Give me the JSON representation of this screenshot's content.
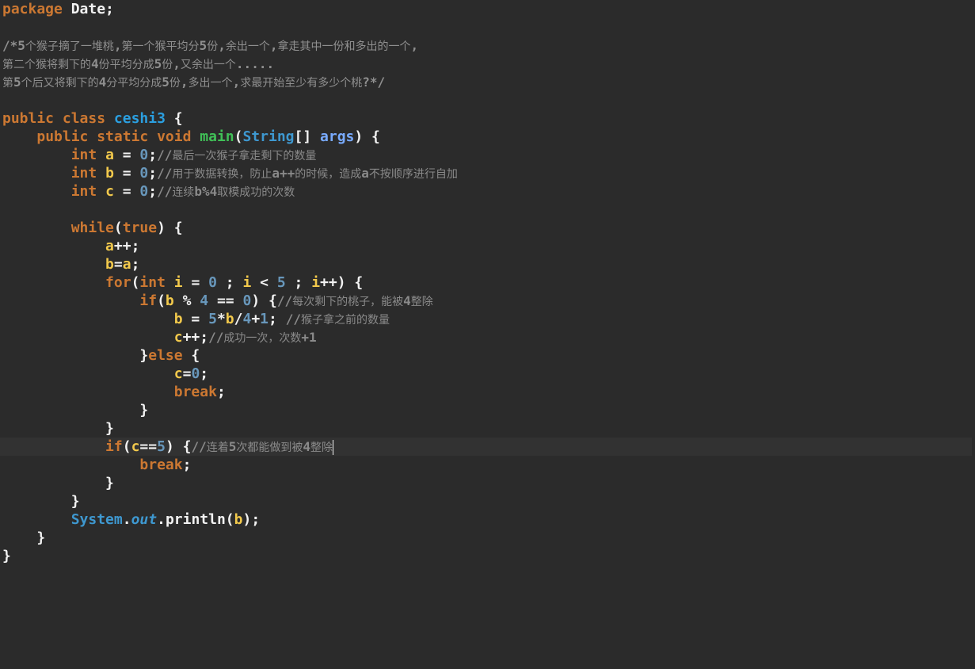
{
  "editor": {
    "lines": [
      {
        "id": "l01",
        "tokens": [
          [
            "kw",
            "package"
          ],
          [
            "plain",
            " Date;"
          ]
        ]
      },
      {
        "id": "l03",
        "tokens": [
          [
            "hdr",
            "/*5个猴子摘了一堆桃,第一个猴平均分5份,余出一个,拿走其中一份和多出的一个,"
          ]
        ]
      },
      {
        "id": "l04",
        "tokens": [
          [
            "hdr",
            "第二个猴将剩下的4份平均分成5份,又余出一个....."
          ]
        ]
      },
      {
        "id": "l05",
        "tokens": [
          [
            "hdr",
            "第5个后又将剩下的4分平均分成5份,多出一个,求最开始至少有多少个桃?*/"
          ]
        ]
      },
      {
        "id": "l07",
        "tokens": [
          [
            "kw",
            "public class "
          ],
          [
            "cls",
            "ceshi3"
          ],
          [
            "plain",
            " {"
          ]
        ]
      },
      {
        "id": "l08",
        "tokens": [
          [
            "plain",
            "    "
          ],
          [
            "kw",
            "public static void "
          ],
          [
            "fn",
            "main"
          ],
          [
            "plain",
            "("
          ],
          [
            "ty",
            "String"
          ],
          [
            "plain",
            "[] "
          ],
          [
            "arg",
            "args"
          ],
          [
            "plain",
            ") {"
          ]
        ]
      },
      {
        "id": "l09",
        "tokens": [
          [
            "plain",
            "        "
          ],
          [
            "kw",
            "int "
          ],
          [
            "var",
            "a"
          ],
          [
            "plain",
            " = "
          ],
          [
            "num",
            "0"
          ],
          [
            "plain",
            ";"
          ],
          [
            "cmt",
            "//最后一次猴子拿走剩下的数量"
          ]
        ]
      },
      {
        "id": "l10",
        "tokens": [
          [
            "plain",
            "        "
          ],
          [
            "kw",
            "int "
          ],
          [
            "var",
            "b"
          ],
          [
            "plain",
            " = "
          ],
          [
            "num",
            "0"
          ],
          [
            "plain",
            ";"
          ],
          [
            "cmt",
            "//用于数据转换，防止a++的时候，造成a不按顺序进行自加"
          ]
        ]
      },
      {
        "id": "l11",
        "tokens": [
          [
            "plain",
            "        "
          ],
          [
            "kw",
            "int "
          ],
          [
            "var",
            "c"
          ],
          [
            "plain",
            " = "
          ],
          [
            "num",
            "0"
          ],
          [
            "plain",
            ";"
          ],
          [
            "cmt",
            "//连续b%4取模成功的次数"
          ]
        ]
      },
      {
        "id": "l13",
        "tokens": [
          [
            "plain",
            "        "
          ],
          [
            "kw",
            "while"
          ],
          [
            "plain",
            "("
          ],
          [
            "kw",
            "true"
          ],
          [
            "plain",
            ") {"
          ]
        ]
      },
      {
        "id": "l14",
        "tokens": [
          [
            "plain",
            "            "
          ],
          [
            "var",
            "a"
          ],
          [
            "plain",
            "++;"
          ]
        ]
      },
      {
        "id": "l15",
        "tokens": [
          [
            "plain",
            "            "
          ],
          [
            "var",
            "b"
          ],
          [
            "plain",
            "="
          ],
          [
            "var",
            "a"
          ],
          [
            "plain",
            ";"
          ]
        ]
      },
      {
        "id": "l16",
        "tokens": [
          [
            "plain",
            "            "
          ],
          [
            "kw",
            "for"
          ],
          [
            "plain",
            "("
          ],
          [
            "kw",
            "int "
          ],
          [
            "var",
            "i"
          ],
          [
            "plain",
            " = "
          ],
          [
            "num",
            "0"
          ],
          [
            "plain",
            " ; "
          ],
          [
            "var",
            "i"
          ],
          [
            "plain",
            " < "
          ],
          [
            "num",
            "5"
          ],
          [
            "plain",
            " ; "
          ],
          [
            "var",
            "i"
          ],
          [
            "plain",
            "++) {"
          ]
        ]
      },
      {
        "id": "l17",
        "tokens": [
          [
            "plain",
            "                "
          ],
          [
            "kw",
            "if"
          ],
          [
            "plain",
            "("
          ],
          [
            "var",
            "b"
          ],
          [
            "plain",
            " % "
          ],
          [
            "num",
            "4"
          ],
          [
            "plain",
            " == "
          ],
          [
            "num",
            "0"
          ],
          [
            "plain",
            ") {"
          ],
          [
            "cmt",
            "//每次剩下的桃子，能被4整除"
          ]
        ]
      },
      {
        "id": "l18",
        "tokens": [
          [
            "plain",
            "                    "
          ],
          [
            "var",
            "b"
          ],
          [
            "plain",
            " = "
          ],
          [
            "num",
            "5"
          ],
          [
            "plain",
            "*"
          ],
          [
            "var",
            "b"
          ],
          [
            "plain",
            "/"
          ],
          [
            "num",
            "4"
          ],
          [
            "plain",
            "+"
          ],
          [
            "num",
            "1"
          ],
          [
            "plain",
            "; "
          ],
          [
            "cmt",
            "//猴子拿之前的数量"
          ]
        ]
      },
      {
        "id": "l19",
        "tokens": [
          [
            "plain",
            "                    "
          ],
          [
            "var",
            "c"
          ],
          [
            "plain",
            "++;"
          ],
          [
            "cmt",
            "//成功一次，次数+1"
          ]
        ]
      },
      {
        "id": "l20",
        "tokens": [
          [
            "plain",
            "                }"
          ],
          [
            "kw",
            "else"
          ],
          [
            "plain",
            " {"
          ]
        ]
      },
      {
        "id": "l21",
        "tokens": [
          [
            "plain",
            "                    "
          ],
          [
            "var",
            "c"
          ],
          [
            "plain",
            "="
          ],
          [
            "num",
            "0"
          ],
          [
            "plain",
            ";"
          ]
        ]
      },
      {
        "id": "l22",
        "tokens": [
          [
            "plain",
            "                    "
          ],
          [
            "kw",
            "break"
          ],
          [
            "plain",
            ";"
          ]
        ]
      },
      {
        "id": "l23",
        "tokens": [
          [
            "plain",
            "                }"
          ]
        ]
      },
      {
        "id": "l24",
        "tokens": [
          [
            "plain",
            "            }"
          ]
        ]
      },
      {
        "id": "l25",
        "tokens": [
          [
            "plain",
            "            "
          ],
          [
            "kw",
            "if"
          ],
          [
            "plain",
            "("
          ],
          [
            "var",
            "c"
          ],
          [
            "plain",
            "=="
          ],
          [
            "num",
            "5"
          ],
          [
            "plain",
            ") {"
          ],
          [
            "cmt",
            "//连着5次都能做到被4整除"
          ]
        ]
      },
      {
        "id": "l26",
        "tokens": [
          [
            "plain",
            "                "
          ],
          [
            "kw",
            "break"
          ],
          [
            "plain",
            ";"
          ]
        ]
      },
      {
        "id": "l27",
        "tokens": [
          [
            "plain",
            "            }"
          ]
        ]
      },
      {
        "id": "l28",
        "tokens": [
          [
            "plain",
            "        }"
          ]
        ]
      },
      {
        "id": "l29",
        "tokens": [
          [
            "plain",
            "        "
          ],
          [
            "ty",
            "System"
          ],
          [
            "plain",
            "."
          ],
          [
            "stat",
            "out"
          ],
          [
            "plain",
            "."
          ],
          [
            "plain",
            "println("
          ],
          [
            "var",
            "b"
          ],
          [
            "plain",
            ");"
          ]
        ]
      },
      {
        "id": "l30",
        "tokens": [
          [
            "plain",
            "    }"
          ]
        ]
      },
      {
        "id": "l31",
        "tokens": [
          [
            "plain",
            "}"
          ]
        ]
      }
    ]
  }
}
